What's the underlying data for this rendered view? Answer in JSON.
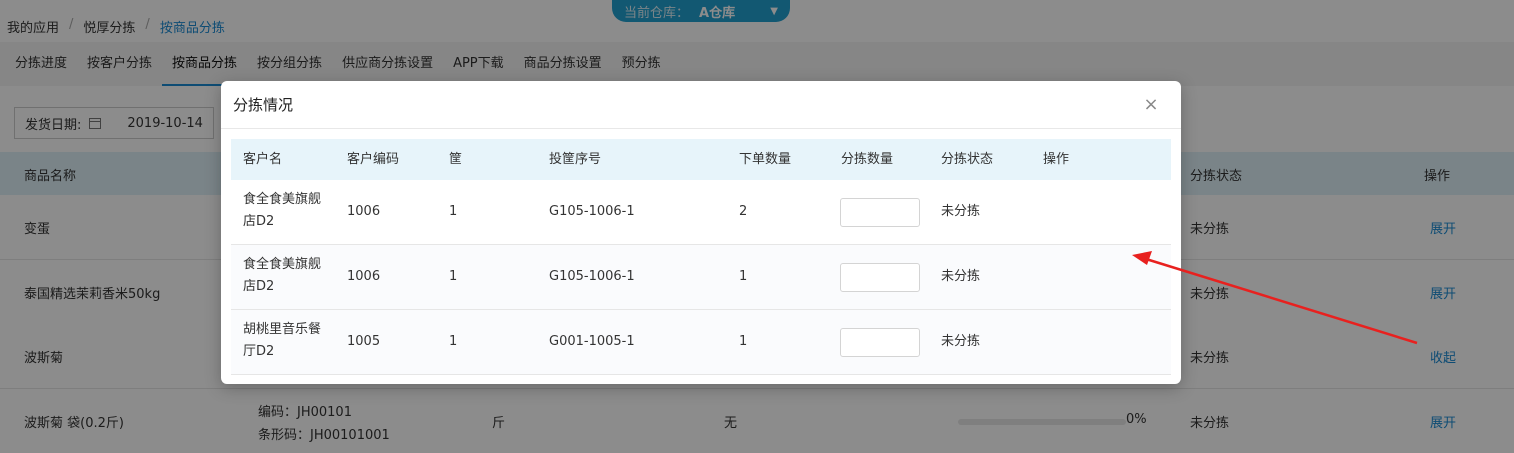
{
  "breadcrumb": {
    "item1": "我的应用",
    "item2": "悦厚分拣",
    "item3": "按商品分拣"
  },
  "warehouse": {
    "label": "当前仓库：",
    "value": "A仓库"
  },
  "tabs": [
    "分拣进度",
    "按客户分拣",
    "按商品分拣",
    "按分组分拣",
    "供应商分拣设置",
    "APP下载",
    "商品分拣设置",
    "预分拣"
  ],
  "filter": {
    "label": "发货日期:",
    "value": "2019-10-14"
  },
  "main_table": {
    "headers": {
      "name": "商品名称",
      "status": "分拣状态",
      "action": "操作"
    },
    "rows": [
      {
        "name": "变蛋",
        "status": "未分拣",
        "action": "展开"
      },
      {
        "name": "泰国精选茉莉香米50kg",
        "status": "未分拣",
        "action": "展开"
      },
      {
        "name": "波斯菊",
        "status": "未分拣",
        "action": "收起"
      },
      {
        "name": "波斯菊 袋(0.2斤)",
        "code": "编码：JH00101",
        "barcode": "条形码：JH00101001",
        "unit": "斤",
        "remark": "无",
        "progress": "0%",
        "status": "未分拣",
        "action": "展开"
      }
    ]
  },
  "modal": {
    "title": "分拣情况",
    "close": "×",
    "headers": [
      "客户名",
      "客户编码",
      "筐",
      "投筐序号",
      "下单数量",
      "分拣数量",
      "分拣状态",
      "操作"
    ],
    "rows": [
      {
        "customer_line1": "食全食美旗舰",
        "customer_line2": "店D2",
        "code": "1006",
        "basket": "1",
        "seq": "G105-1006-1",
        "qty": "2",
        "status": "未分拣"
      },
      {
        "customer_line1": "食全食美旗舰",
        "customer_line2": "店D2",
        "code": "1006",
        "basket": "1",
        "seq": "G105-1006-1",
        "qty": "1",
        "status": "未分拣"
      },
      {
        "customer_line1": "胡桃里音乐餐",
        "customer_line2": "厅D2",
        "code": "1005",
        "basket": "1",
        "seq": "G001-1005-1",
        "qty": "1",
        "status": "未分拣"
      }
    ]
  },
  "colors": {
    "accent": "#1a8bd4",
    "arrow": "#e8211f"
  }
}
